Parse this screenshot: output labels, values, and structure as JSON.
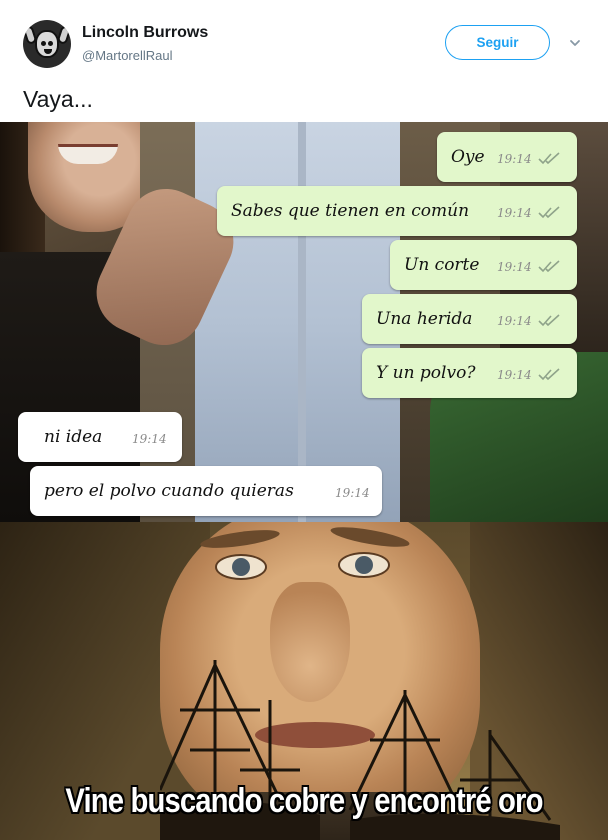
{
  "tweet": {
    "author_name": "Lincoln Burrows",
    "author_handle": "@MartorellRaul",
    "follow_label": "Seguir",
    "text": "Vaya..."
  },
  "chat": {
    "outgoing": [
      {
        "text": "Oye",
        "time": "19:14"
      },
      {
        "text": "Sabes que tienen en común",
        "time": "19:14"
      },
      {
        "text": "Un corte",
        "time": "19:14"
      },
      {
        "text": "Una herida",
        "time": "19:14"
      },
      {
        "text": "Y un polvo?",
        "time": "19:14"
      }
    ],
    "incoming": [
      {
        "text": "ni idea",
        "time": "19:14"
      },
      {
        "text": "pero el polvo cuando quieras",
        "time": "19:14"
      }
    ],
    "read_tick_color": "#8fa38a"
  },
  "meme": {
    "caption": "Vine buscando cobre y encontré oro"
  },
  "colors": {
    "accent": "#1da1f2",
    "handle": "#657786",
    "outgoing_bubble": "#e2f7cb",
    "incoming_bubble": "#ffffff"
  },
  "icons": {
    "menu_caret": "chevron-down-icon",
    "read_receipt": "double-check-icon"
  }
}
